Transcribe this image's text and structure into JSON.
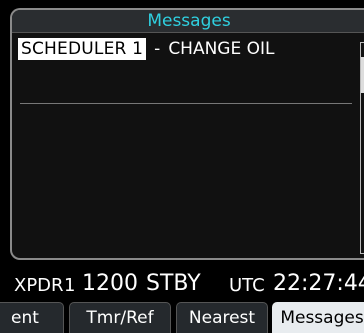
{
  "messages_window": {
    "title": "Messages",
    "messages": [
      {
        "source": "SCHEDULER 1",
        "separator": "-",
        "text": "CHANGE OIL"
      }
    ]
  },
  "status_bar": {
    "xpdr_label": "XPDR",
    "xpdr_id": "1",
    "squawk_code": "1200",
    "mode": "STBY",
    "utc_label": "UTC",
    "utc_time": "22:27:44"
  },
  "tabs": [
    {
      "label": "ent",
      "selected": false
    },
    {
      "label": "Tmr/Ref",
      "selected": false
    },
    {
      "label": "Nearest",
      "selected": false
    },
    {
      "label": "Messages",
      "selected": true
    }
  ],
  "colors": {
    "title_text": "#2fd0e0",
    "selected_tab": "#e8ecef",
    "tab_background": "#25292d"
  }
}
